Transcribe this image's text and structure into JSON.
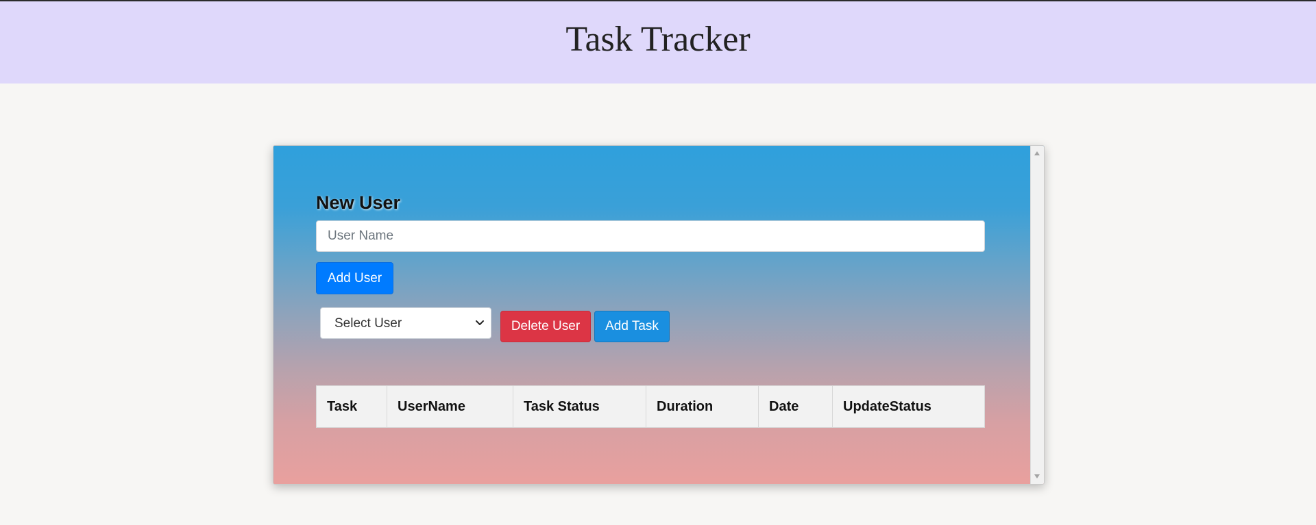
{
  "header": {
    "title": "Task Tracker"
  },
  "new_user": {
    "title": "New User",
    "input_placeholder": "User Name",
    "input_value": "",
    "add_button": "Add User"
  },
  "controls": {
    "select_value": "Select User",
    "delete_button": "Delete User",
    "add_task_button": "Add Task"
  },
  "table": {
    "columns": [
      "Task",
      "UserName",
      "Task Status",
      "Duration",
      "Date",
      "UpdateStatus"
    ]
  },
  "colors": {
    "header_bg": "#dfd8fb",
    "primary": "#007bff",
    "danger": "#dc3545",
    "info": "#1a8fe0"
  }
}
